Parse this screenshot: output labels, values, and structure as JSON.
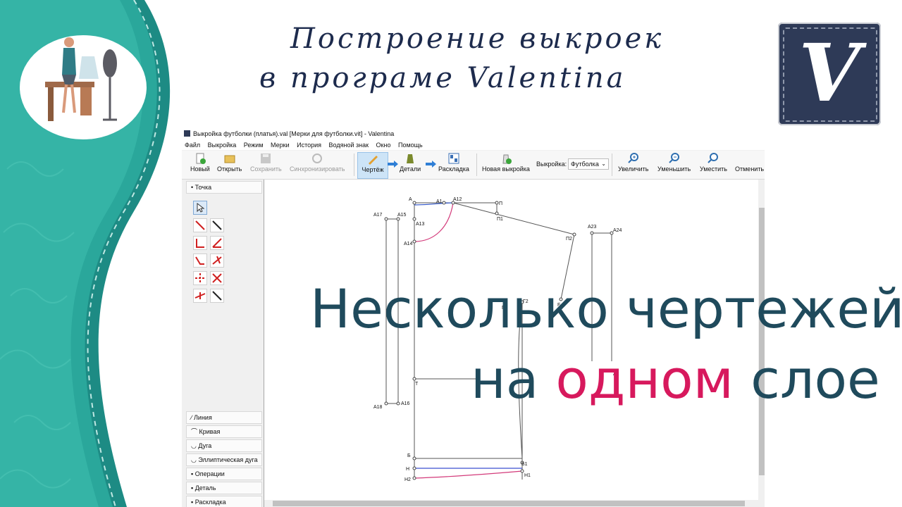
{
  "header": {
    "line1": "Построение выкроек",
    "line2": "в програме Valentina",
    "logo_letter": "V"
  },
  "app": {
    "window_title": "Выкройка футболки (платья).val [Мерки для футболки.vit] - Valentina",
    "menu": [
      "Файл",
      "Выкройка",
      "Режим",
      "Мерки",
      "История",
      "Водяной знак",
      "Окно",
      "Помощь"
    ],
    "toolbar": {
      "new": "Новый",
      "open": "Открыть",
      "save": "Сохранить",
      "sync": "Синхронизировать",
      "draft": "Чертёж",
      "details": "Детали",
      "layout": "Раскладка",
      "new_pattern": "Новая выкройка",
      "pattern_label": "Выкройка:",
      "pattern_value": "Футболка",
      "zoom_in": "Увеличить",
      "zoom_out": "Уменьшить",
      "fit": "Уместить",
      "cancel": "Отменить"
    },
    "panels": {
      "point": "Точка",
      "line": "Линия",
      "curve": "Кривая",
      "arc": "Дуга",
      "elliptic_arc": "Эллиптическая дуга",
      "operations": "Операции",
      "detail": "Деталь",
      "layout": "Раскладка"
    },
    "points": [
      "А",
      "А1",
      "А12",
      "П",
      "П1",
      "А13",
      "А14",
      "А15",
      "А17",
      "П2",
      "А23",
      "А24",
      "Г2",
      "Г",
      "F",
      "А2",
      "Т",
      "А18",
      "А16",
      "Б",
      "Б1",
      "Н",
      "Н1",
      "Н2"
    ]
  },
  "overlay": {
    "line1": "Несколько чертежей",
    "line2_a": "на ",
    "line2_b": "одном",
    "line2_c": " слое"
  },
  "colors": {
    "teal": "#2aa79b",
    "dark_teal": "#1d8b84",
    "navy_text": "#1f4a5c",
    "accent": "#d7195d",
    "logo_bg": "#2e3a57"
  }
}
